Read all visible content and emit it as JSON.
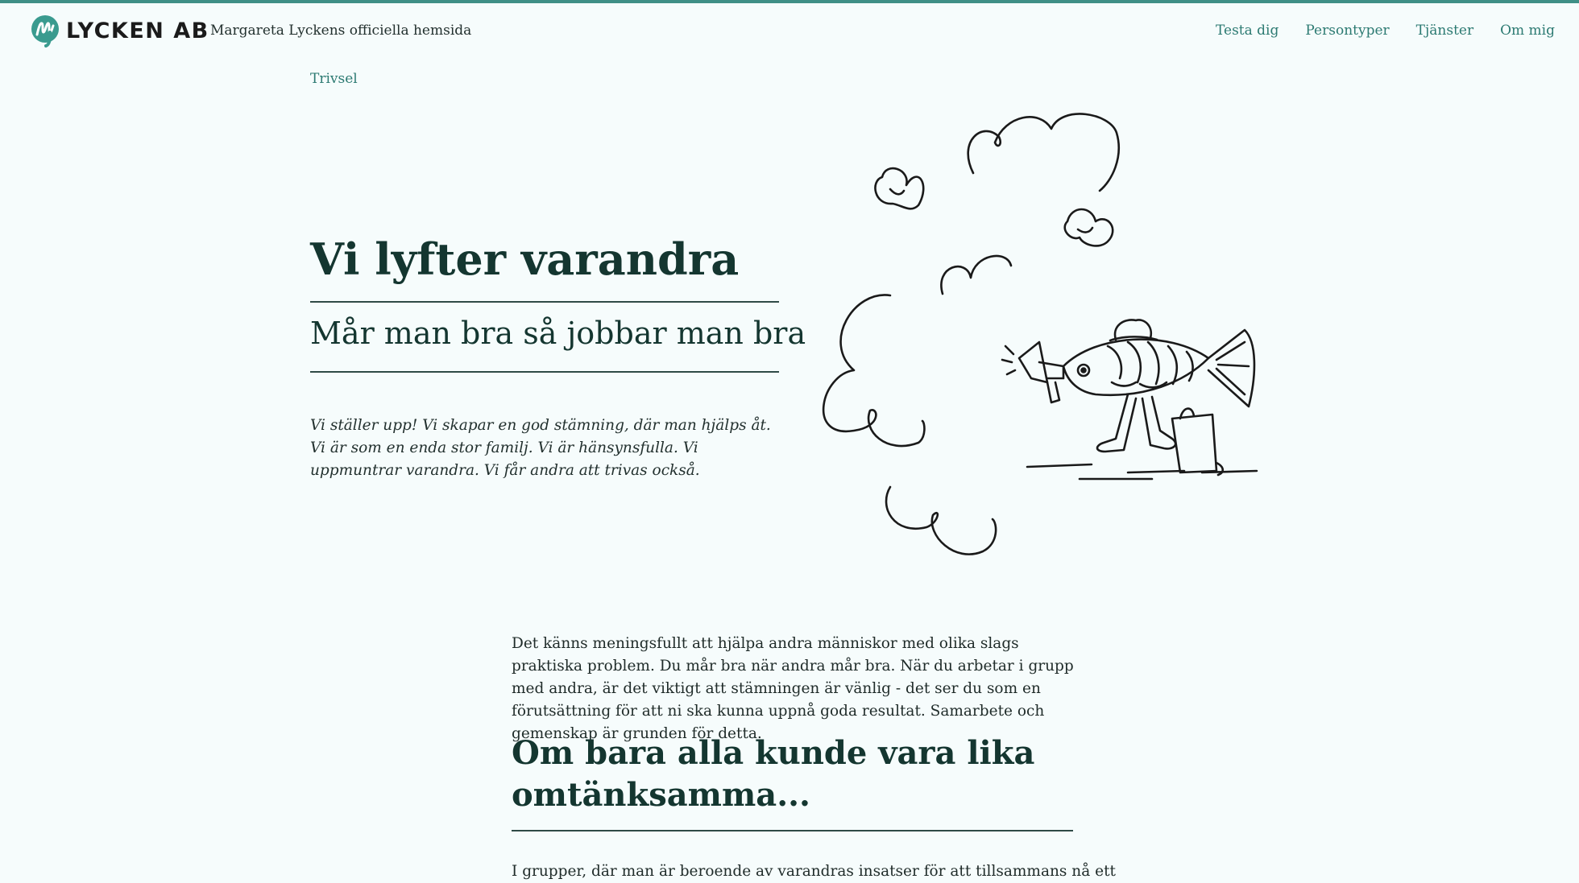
{
  "brand": {
    "logo_text": "LYCKEN AB",
    "tagline": "Margareta Lyckens officiella hemsida",
    "accent_color": "#3f8f86",
    "link_color": "#2c7a72"
  },
  "nav": {
    "items": [
      {
        "label": "Testa dig"
      },
      {
        "label": "Persontyper"
      },
      {
        "label": "Tjänster"
      },
      {
        "label": "Om mig"
      }
    ]
  },
  "breadcrumb": "Trivsel",
  "hero": {
    "title": "Vi lyfter varandra",
    "subtitle": "Mår man bra så jobbar man bra",
    "intro": "Vi ställer upp! Vi skapar en god stämning, där man hjälps åt. Vi är som en enda stor familj. Vi är hänsynsfulla. Vi uppmuntrar varandra. Vi får andra att trivas också."
  },
  "article": {
    "paragraph1": "Det känns meningsfullt att hjälpa andra människor med olika slags praktiska problem. Du mår bra när andra mår bra. När du arbetar i grupp med andra, är det viktigt att stämningen är vänlig - det ser du som en förutsättning för att ni ska kunna uppnå goda resultat. Samarbete och gemenskap är grunden för detta.",
    "heading": "Om bara alla kunde vara lika omtänksamma...",
    "paragraph2": "I grupper, där man är beroende av varandras insatser för att tillsammans nå ett"
  },
  "illustration": {
    "icon": "fish-with-megaphone-illustration"
  }
}
